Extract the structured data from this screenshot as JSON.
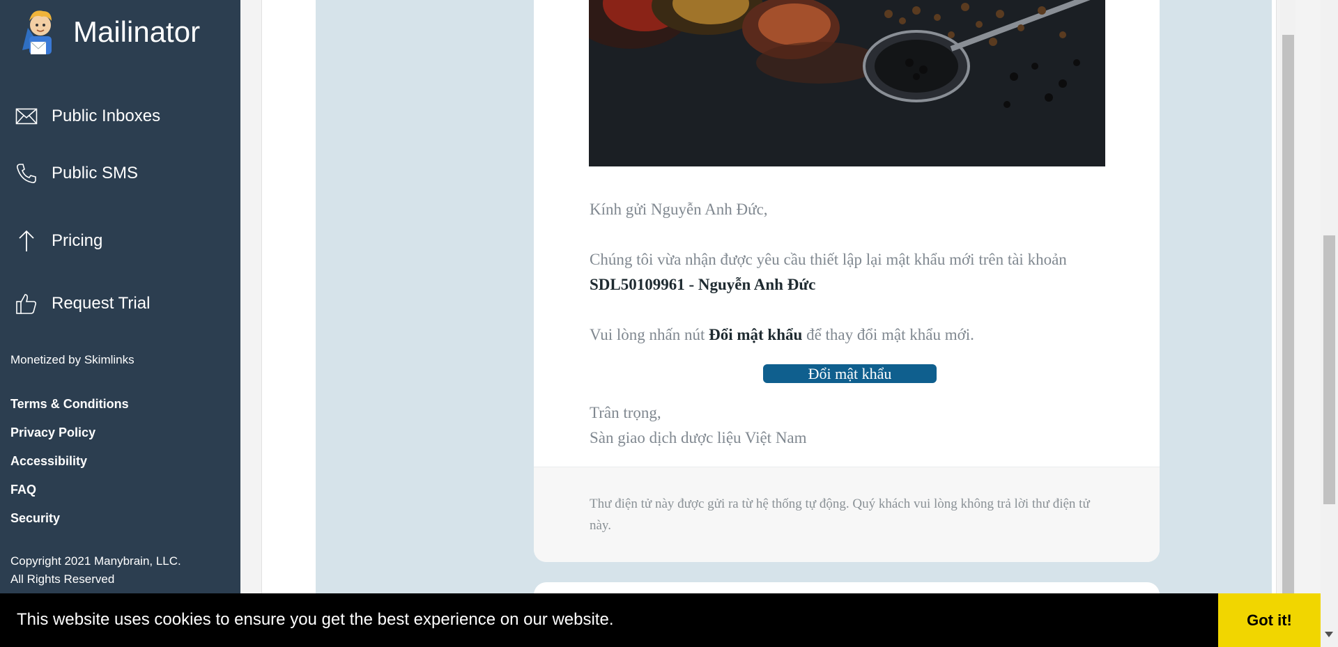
{
  "brand": {
    "name": "Mailinator"
  },
  "sidebar": {
    "items": [
      {
        "label": "Public Inboxes",
        "icon": "envelope-icon"
      },
      {
        "label": "Public SMS",
        "icon": "phone-icon"
      },
      {
        "label": "Pricing",
        "icon": "arrow-up-icon"
      },
      {
        "label": "Request Trial",
        "icon": "thumbs-up-icon"
      }
    ],
    "monetized": "Monetized by Skimlinks",
    "links": [
      "Terms & Conditions",
      "Privacy Policy",
      "Accessibility",
      "FAQ",
      "Security"
    ],
    "copyright_line1": "Copyright 2021 Manybrain, LLC.",
    "copyright_line2": "All Rights Reserved"
  },
  "email": {
    "greeting": "Kính gửi Nguyễn Anh Đức,",
    "line1": "Chúng tôi vừa nhận được yêu cầu thiết lập lại mật khẩu mới trên tài khoản",
    "account": "SDL50109961 - Nguyễn Anh Đức",
    "line2_prefix": "Vui lòng nhấn nút",
    "line2_bold": "Đổi mật khẩu",
    "line2_suffix": "để thay đổi mật khẩu mới.",
    "button_label": "Đổi mật khẩu",
    "signoff": "Trân trọng,",
    "signature": "Sàn giao dịch dược liệu Việt Nam",
    "footer_note": "Thư điện tử này được gửi ra từ hệ thống tự động. Quý khách vui lòng không trả lời thư điện tử này."
  },
  "cookie": {
    "message": "This website uses cookies to ensure you get the best experience on our website.",
    "button": "Got it!"
  },
  "colors": {
    "sidebar_bg": "#2c3e50",
    "mail_bg": "#d6e3ea",
    "button_bg": "#0f5f8e",
    "cookie_button": "#f1d600"
  }
}
